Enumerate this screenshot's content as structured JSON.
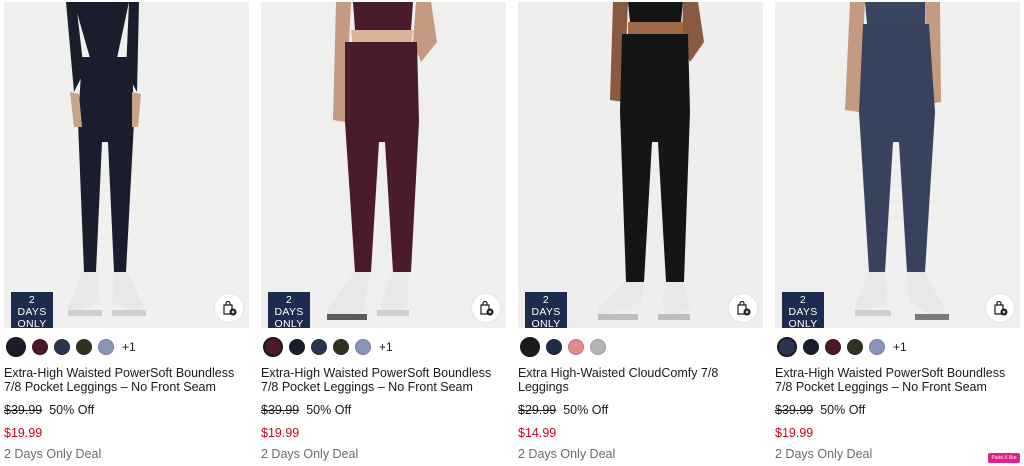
{
  "products": [
    {
      "badge": "2 DAYS ONLY",
      "title": "Extra-High Waisted PowerSoft Boundless 7/8 Pocket Leggings – No Front Seam",
      "original_price": "$39.99",
      "discount": "50% Off",
      "sale_price": "$19.99",
      "deal": "2 Days Only Deal",
      "more_colors": "+1",
      "swatches": [
        "#1a1d2b",
        "#4a1a26",
        "#2c3550",
        "#2e3322",
        "#8a93b8"
      ],
      "legging_color": "#1a1d2c",
      "bg_color": "#f0f0ee"
    },
    {
      "badge": "2 DAYS ONLY",
      "title": "Extra-High Waisted PowerSoft Boundless 7/8 Pocket Leggings – No Front Seam",
      "original_price": "$39.99",
      "discount": "50% Off",
      "sale_price": "$19.99",
      "deal": "2 Days Only Deal",
      "more_colors": "+1",
      "swatches": [
        "#4a1a26",
        "#1a1d2b",
        "#2c3550",
        "#2e3322",
        "#8a93b8"
      ],
      "legging_color": "#4a1b2b",
      "bg_color": "#efefed"
    },
    {
      "badge": "2 DAYS ONLY",
      "title": "Extra High-Waisted CloudComfy 7/8 Leggings",
      "original_price": "$29.99",
      "discount": "50% Off",
      "sale_price": "$14.99",
      "deal": "2 Days Only Deal",
      "more_colors": "",
      "swatches": [
        "#1a1a1a",
        "#1f2a44",
        "#e08a8a",
        "#b5b5b5"
      ],
      "legging_color": "#151515",
      "bg_color": "#efeeec"
    },
    {
      "badge": "2 DAYS ONLY",
      "title": "Extra-High Waisted PowerSoft Boundless 7/8 Pocket Leggings – No Front Seam",
      "original_price": "$39.99",
      "discount": "50% Off",
      "sale_price": "$19.99",
      "deal": "2 Days Only Deal",
      "more_colors": "+1",
      "swatches": [
        "#2c3550",
        "#1a1d2b",
        "#4a1a26",
        "#2e3322",
        "#8a93b8"
      ],
      "legging_color": "#38425c",
      "bg_color": "#efefed"
    }
  ],
  "corner_tag": "Paint X like"
}
